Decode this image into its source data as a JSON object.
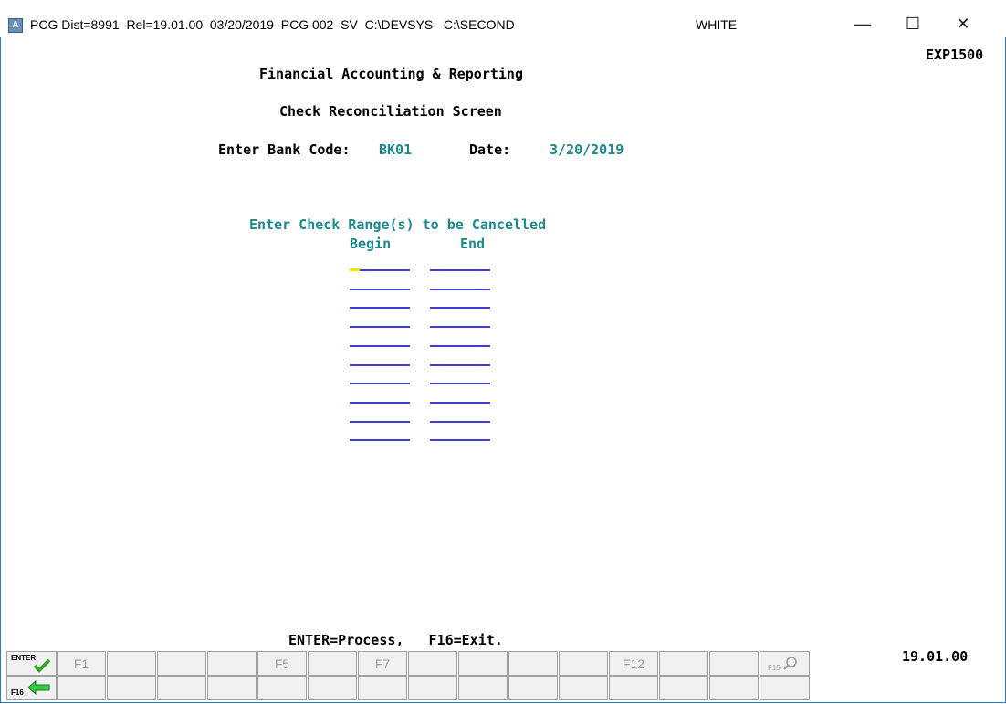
{
  "titlebar": {
    "text": "PCG Dist=8991  Rel=19.01.00  03/20/2019  PCG 002  SV  C:\\DEVSYS   C:\\SECOND",
    "user": "WHITE",
    "minimize": "—",
    "maximize": "☐",
    "close": "✕"
  },
  "screen": {
    "program_id": "EXP1500",
    "title1": "Financial Accounting & Reporting",
    "title2": "Check Reconciliation Screen",
    "bank_label": "Enter Bank Code:",
    "bank_value": "BK01",
    "date_label": "Date:",
    "date_value": "3/20/2019",
    "range_heading": "Enter Check Range(s) to be Cancelled",
    "col_begin": "Begin",
    "col_end": "End",
    "footer_help": "ENTER=Process,   F16=Exit.",
    "version": "19.01.00"
  },
  "fkeys": {
    "enter": "ENTER",
    "f1": "F1",
    "f5": "F5",
    "f7": "F7",
    "f12": "F12",
    "f15": "F15",
    "f16": "F16"
  },
  "colors": {
    "teal": "#1a8a8f",
    "field_line": "#3d3dd6",
    "cursor": "#f2e600"
  }
}
